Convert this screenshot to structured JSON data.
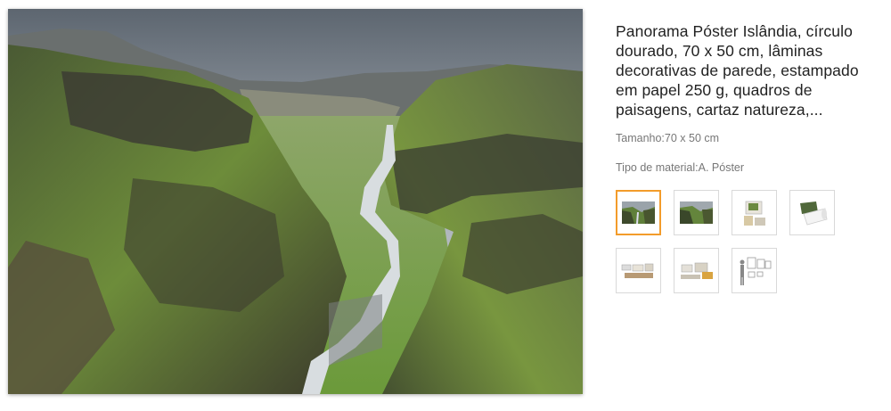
{
  "product": {
    "title": "Panorama Póster Islândia, círculo dourado, 70 x 50 cm, lâminas decorativas de parede, estampado em papel 250 g, quadros de paisagens, cartaz natureza,...",
    "size_label": "Tamanho:",
    "size_value": "70 x 50 cm",
    "material_label": "Tipo de material:",
    "material_value": "A. Póster"
  },
  "thumbnails": [
    {
      "icon": "landscape-poster-thumbnail",
      "selected": true
    },
    {
      "icon": "landscape-closeup-thumbnail",
      "selected": false
    },
    {
      "icon": "packaging-thumbnail",
      "selected": false
    },
    {
      "icon": "paper-roll-thumbnail",
      "selected": false
    },
    {
      "icon": "room-wall-thumbnail",
      "selected": false
    },
    {
      "icon": "living-room-thumbnail",
      "selected": false
    },
    {
      "icon": "size-comparison-thumbnail",
      "selected": false
    }
  ],
  "colors": {
    "accent": "#f39c2b",
    "border": "#d9d9d9",
    "muted_text": "#777777"
  }
}
